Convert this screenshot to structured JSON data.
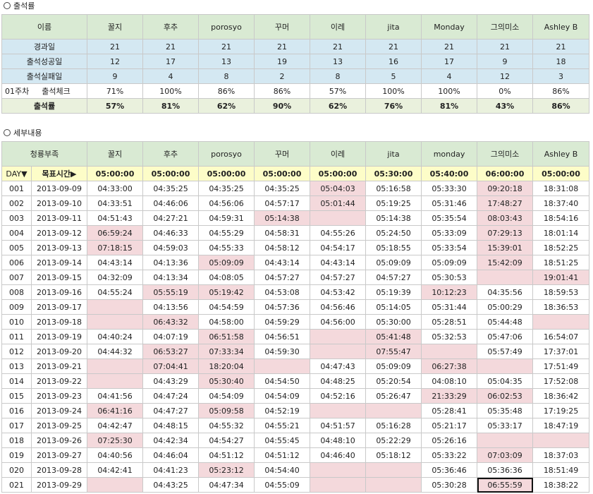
{
  "attendance": {
    "title": "출석률",
    "header": [
      "이름",
      "꿀지",
      "후추",
      "porosyo",
      "꾸머",
      "이레",
      "jita",
      "Monday",
      "그의미소",
      "Ashley B"
    ],
    "rows": [
      {
        "label": "경과일",
        "values": [
          "21",
          "21",
          "21",
          "21",
          "21",
          "21",
          "21",
          "21",
          "21"
        ]
      },
      {
        "label": "출석성공일",
        "values": [
          "12",
          "17",
          "13",
          "19",
          "13",
          "16",
          "17",
          "9",
          "18"
        ]
      },
      {
        "label": "출석실패일",
        "values": [
          "9",
          "4",
          "8",
          "2",
          "8",
          "5",
          "4",
          "12",
          "3"
        ]
      }
    ],
    "week_label": "01주차",
    "check_label": "출석체크",
    "check_values": [
      "71%",
      "100%",
      "86%",
      "86%",
      "57%",
      "100%",
      "100%",
      "0%",
      "86%"
    ],
    "rate_label": "출석률",
    "rate_values": [
      "57%",
      "81%",
      "62%",
      "90%",
      "62%",
      "76%",
      "81%",
      "43%",
      "86%"
    ]
  },
  "details": {
    "title": "세부내용",
    "header": [
      "청룡부족",
      "꿀지",
      "후추",
      "porosyo",
      "꾸머",
      "이레",
      "jita",
      "monday",
      "그의미소",
      "Ashley B"
    ],
    "day_label": "DAY▼",
    "goal_label": "목표시간▶",
    "goal_times": [
      "05:00:00",
      "05:00:00",
      "05:00:00",
      "05:00:00",
      "05:00:00",
      "05:30:00",
      "05:40:00",
      "06:00:00",
      "05:00:00"
    ],
    "rows": [
      {
        "day": "001",
        "date": "2013-09-09",
        "times": [
          "04:33:00",
          "04:35:25",
          "04:35:25",
          "04:35:25",
          "05:04:03",
          "05:16:58",
          "05:33:30",
          "09:20:18",
          "18:31:08"
        ],
        "late": [
          4,
          7
        ]
      },
      {
        "day": "002",
        "date": "2013-09-10",
        "times": [
          "04:33:51",
          "04:46:06",
          "04:56:06",
          "04:57:17",
          "05:01:44",
          "05:19:25",
          "05:31:46",
          "17:48:27",
          "18:37:40"
        ],
        "late": [
          4,
          7
        ]
      },
      {
        "day": "003",
        "date": "2013-09-11",
        "times": [
          "04:51:43",
          "04:27:21",
          "04:59:31",
          "05:14:38",
          "",
          "05:14:38",
          "05:35:54",
          "08:03:43",
          "18:54:16"
        ],
        "late": [
          3,
          4,
          7
        ]
      },
      {
        "day": "004",
        "date": "2013-09-12",
        "times": [
          "06:59:24",
          "04:46:33",
          "04:55:29",
          "04:58:31",
          "04:55:26",
          "05:24:50",
          "05:33:09",
          "07:29:13",
          "18:01:14"
        ],
        "late": [
          0,
          7
        ]
      },
      {
        "day": "005",
        "date": "2013-09-13",
        "times": [
          "07:18:15",
          "04:59:03",
          "04:55:33",
          "04:58:12",
          "04:54:17",
          "05:18:55",
          "05:33:54",
          "15:39:01",
          "18:52:25"
        ],
        "late": [
          0,
          7
        ]
      },
      {
        "day": "006",
        "date": "2013-09-14",
        "times": [
          "04:43:14",
          "04:13:36",
          "05:09:09",
          "04:43:14",
          "04:43:14",
          "05:09:09",
          "05:09:09",
          "15:42:09",
          "18:51:25"
        ],
        "late": [
          2,
          7
        ]
      },
      {
        "day": "007",
        "date": "2013-09-15",
        "times": [
          "04:32:09",
          "04:13:34",
          "04:08:05",
          "04:57:27",
          "04:57:27",
          "04:57:27",
          "05:30:53",
          "",
          "19:01:41"
        ],
        "late": [
          7,
          8
        ]
      },
      {
        "day": "008",
        "date": "2013-09-16",
        "times": [
          "04:55:24",
          "05:55:19",
          "05:19:42",
          "04:53:08",
          "04:53:42",
          "05:19:39",
          "10:12:23",
          "04:35:56",
          "18:59:53"
        ],
        "late": [
          1,
          2,
          6
        ]
      },
      {
        "day": "009",
        "date": "2013-09-17",
        "times": [
          "",
          "04:13:56",
          "04:54:59",
          "04:57:36",
          "04:56:46",
          "05:14:05",
          "05:31:44",
          "05:00:29",
          "18:36:53"
        ],
        "late": [
          0
        ]
      },
      {
        "day": "010",
        "date": "2013-09-18",
        "times": [
          "",
          "06:43:32",
          "04:58:00",
          "04:59:29",
          "04:56:00",
          "05:30:00",
          "05:28:51",
          "05:44:48",
          ""
        ],
        "late": [
          0,
          1,
          8
        ]
      },
      {
        "day": "011",
        "date": "2013-09-19",
        "times": [
          "04:40:24",
          "04:07:19",
          "06:51:58",
          "04:56:51",
          "",
          "05:41:48",
          "05:32:53",
          "05:47:06",
          "16:54:07"
        ],
        "late": [
          2,
          4,
          5
        ]
      },
      {
        "day": "012",
        "date": "2013-09-20",
        "times": [
          "04:44:32",
          "06:53:27",
          "07:33:34",
          "04:59:30",
          "",
          "07:55:47",
          "",
          "05:57:49",
          "17:37:01"
        ],
        "late": [
          1,
          2,
          4,
          5,
          6
        ]
      },
      {
        "day": "013",
        "date": "2013-09-21",
        "times": [
          "",
          "07:04:41",
          "18:20:04",
          "",
          "04:47:43",
          "05:09:09",
          "06:27:38",
          "",
          "17:51:49"
        ],
        "late": [
          0,
          1,
          2,
          3,
          6,
          7
        ]
      },
      {
        "day": "014",
        "date": "2013-09-22",
        "times": [
          "",
          "04:43:29",
          "05:30:40",
          "04:54:50",
          "04:48:25",
          "05:20:54",
          "04:08:10",
          "05:04:35",
          "17:52:08"
        ],
        "late": [
          0,
          2
        ]
      },
      {
        "day": "015",
        "date": "2013-09-23",
        "times": [
          "04:41:56",
          "04:47:24",
          "04:54:09",
          "04:54:09",
          "04:52:16",
          "05:26:47",
          "21:33:29",
          "06:02:53",
          "18:36:42"
        ],
        "late": [
          6,
          7
        ]
      },
      {
        "day": "016",
        "date": "2013-09-24",
        "times": [
          "06:41:16",
          "04:47:27",
          "05:09:58",
          "04:52:19",
          "",
          "",
          "05:28:41",
          "05:35:48",
          "17:19:25"
        ],
        "late": [
          0,
          2,
          4,
          5
        ]
      },
      {
        "day": "017",
        "date": "2013-09-25",
        "times": [
          "04:42:47",
          "04:48:15",
          "04:55:32",
          "04:55:21",
          "04:51:57",
          "05:16:28",
          "05:21:17",
          "05:33:17",
          "18:47:19"
        ],
        "late": []
      },
      {
        "day": "018",
        "date": "2013-09-26",
        "times": [
          "07:25:30",
          "04:42:34",
          "04:54:27",
          "04:55:45",
          "04:48:10",
          "05:22:29",
          "05:26:16",
          "",
          ""
        ],
        "late": [
          0,
          7,
          8
        ]
      },
      {
        "day": "019",
        "date": "2013-09-27",
        "times": [
          "04:40:56",
          "04:46:04",
          "04:51:12",
          "04:51:12",
          "04:46:40",
          "05:18:12",
          "05:33:22",
          "07:03:09",
          "18:37:03"
        ],
        "late": [
          7
        ]
      },
      {
        "day": "020",
        "date": "2013-09-28",
        "times": [
          "04:42:41",
          "04:41:23",
          "05:23:12",
          "04:54:40",
          "",
          "",
          "05:36:46",
          "05:36:36",
          "18:51:49"
        ],
        "late": [
          2,
          4,
          5
        ]
      },
      {
        "day": "021",
        "date": "2013-09-29",
        "times": [
          "",
          "04:43:25",
          "04:47:34",
          "04:55:09",
          "",
          "",
          "05:30:28",
          "06:55:59",
          "18:38:22"
        ],
        "late": [
          0,
          4,
          5,
          7
        ]
      }
    ],
    "selected_cell": {
      "row": 20,
      "col": 7
    }
  },
  "colors": {
    "header_green": "#d9ead3",
    "stat_blue": "#d4e8f2",
    "goal_yellow": "#fdfdc8",
    "late_pink": "#f4d9dc",
    "rate_green": "#eaf1dd"
  }
}
